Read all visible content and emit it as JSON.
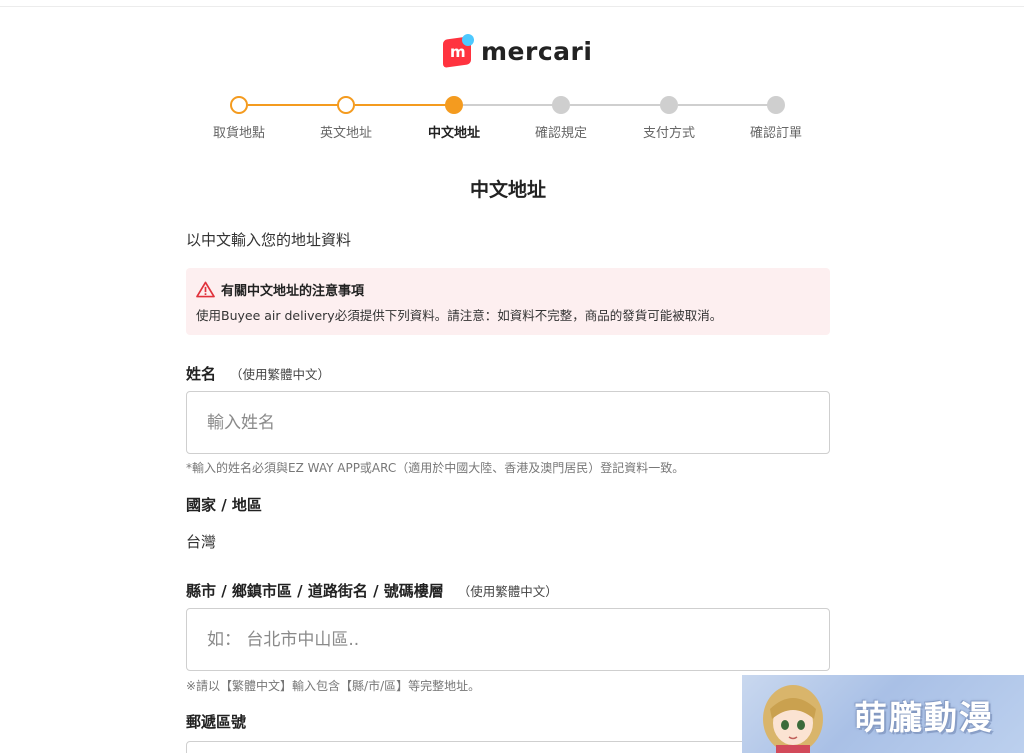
{
  "brand": {
    "name": "mercari",
    "mark_letter": "m",
    "mark_color": "#ff333f",
    "dot_color": "#4dc9ff"
  },
  "stepper": {
    "accent_color": "#f49b1f",
    "current_step": 3,
    "steps": [
      {
        "label": "取貨地點",
        "state": "done"
      },
      {
        "label": "英文地址",
        "state": "done"
      },
      {
        "label": "中文地址",
        "state": "current"
      },
      {
        "label": "確認規定",
        "state": "todo"
      },
      {
        "label": "支付方式",
        "state": "todo"
      },
      {
        "label": "確認訂單",
        "state": "todo"
      }
    ]
  },
  "page": {
    "title": "中文地址",
    "intro": "以中文輸入您的地址資料"
  },
  "notice": {
    "icon": "warning-triangle-icon",
    "heading": "有關中文地址的注意事項",
    "body": "使用Buyee air delivery必須提供下列資料。請注意：如資料不完整，商品的發貨可能被取消。"
  },
  "form": {
    "name": {
      "label": "姓名",
      "hint": "（使用繁體中文）",
      "placeholder": "輸入姓名",
      "note": "*輸入的姓名必須與EZ WAY APP或ARC（適用於中國大陸、香港及澳門居民）登記資料一致。"
    },
    "country": {
      "label": "國家 / 地區",
      "value": "台灣"
    },
    "address": {
      "label": "縣市 / 鄉鎮市區 / 道路街名 / 號碼樓層",
      "hint": "（使用繁體中文）",
      "placeholder": "如： 台北市中山區..",
      "note": "※請以【繁體中文】輸入包含【縣/市/區】等完整地址。"
    },
    "postal": {
      "label": "郵遞區號"
    }
  },
  "watermark": {
    "text": "萌朧動漫"
  }
}
